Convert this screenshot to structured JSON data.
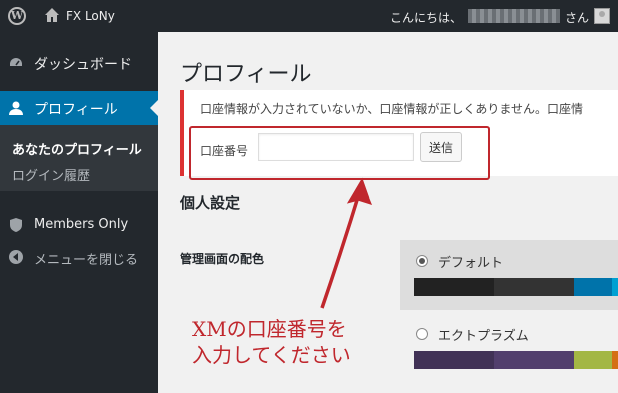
{
  "admin_bar": {
    "site_name": "FX LoNy",
    "greeting": "こんにちは、",
    "suffix": "さん",
    "wp_logo_icon": "wordpress-logo-icon",
    "home_icon": "home-icon"
  },
  "sidebar": {
    "dashboard": "ダッシュボード",
    "profile": "プロフィール",
    "sub_your_profile": "あなたのプロフィール",
    "sub_login_history": "ログイン履歴",
    "members_only": "Members Only",
    "collapse": "メニューを閉じる"
  },
  "main": {
    "title": "プロフィール",
    "notice": "口座情報が入力されていないか、口座情報が正しくありません。口座情",
    "account_label": "口座番号",
    "account_value": "",
    "submit_label": "送信",
    "section_title": "個人設定",
    "color_scheme_label": "管理画面の配色",
    "schemes": [
      {
        "name": "デフォルト",
        "selected": true,
        "colors": [
          "#222222",
          "#333333",
          "#0073aa",
          "#00a0d2"
        ]
      },
      {
        "name": "エクトプラズム",
        "selected": false,
        "colors": [
          "#413256",
          "#523f6d",
          "#a3b745",
          "#d46f15"
        ]
      }
    ]
  },
  "annotation": {
    "line1": "XMの口座番号を",
    "line2": "入力してください",
    "color": "#c0272d"
  },
  "colors": {
    "admin_bar": "#23282d",
    "accent": "#0073aa",
    "notice_border": "#dc3232"
  }
}
